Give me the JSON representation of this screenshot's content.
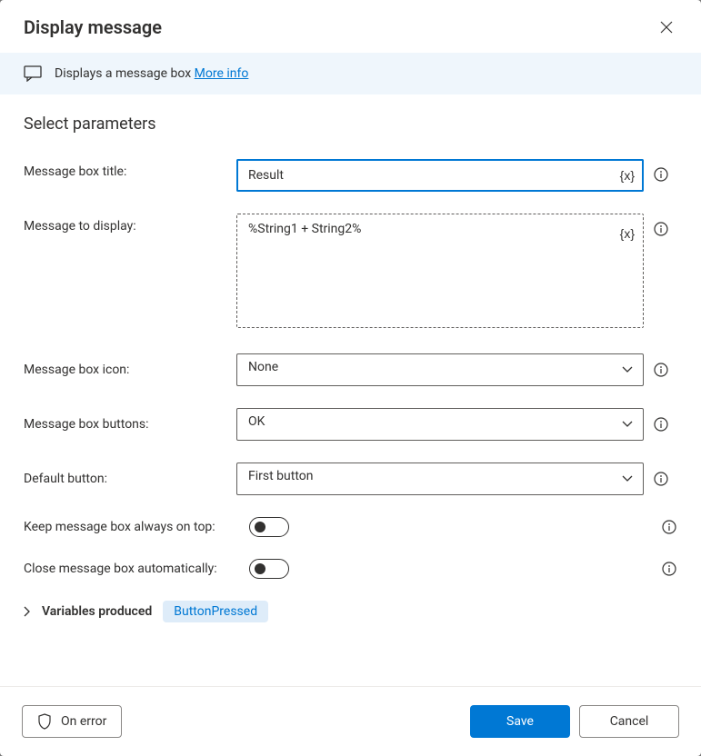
{
  "title": "Display message",
  "infoBar": {
    "text": "Displays a message box ",
    "link": "More info"
  },
  "sectionHeader": "Select parameters",
  "fields": {
    "title": {
      "label": "Message box title:",
      "value": "Result"
    },
    "message": {
      "label": "Message to display:",
      "value": "%String1 + String2%"
    },
    "icon": {
      "label": "Message box icon:",
      "value": "None"
    },
    "buttons": {
      "label": "Message box buttons:",
      "value": "OK"
    },
    "default": {
      "label": "Default button:",
      "value": "First button"
    },
    "onTop": {
      "label": "Keep message box always on top:"
    },
    "autoClose": {
      "label": "Close message box automatically:"
    }
  },
  "variableToken": "{x}",
  "variablesProduced": {
    "label": "Variables produced",
    "value": "ButtonPressed"
  },
  "footer": {
    "onError": "On error",
    "save": "Save",
    "cancel": "Cancel"
  }
}
